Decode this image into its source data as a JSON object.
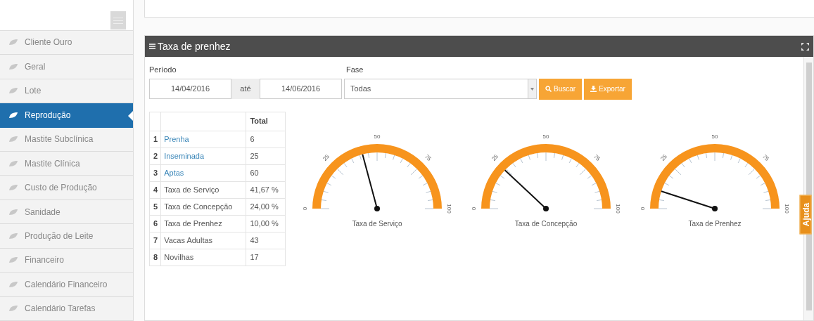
{
  "sidebar": {
    "items": [
      {
        "label": "Cliente Ouro",
        "selected": false
      },
      {
        "label": "Geral",
        "selected": false
      },
      {
        "label": "Lote",
        "selected": false
      },
      {
        "label": "Reprodução",
        "selected": true
      },
      {
        "label": "Mastite Subclínica",
        "selected": false
      },
      {
        "label": "Mastite Clínica",
        "selected": false
      },
      {
        "label": "Custo de Produção",
        "selected": false
      },
      {
        "label": "Sanidade",
        "selected": false
      },
      {
        "label": "Produção de Leite",
        "selected": false
      },
      {
        "label": "Financeiro",
        "selected": false
      },
      {
        "label": "Calendário Financeiro",
        "selected": false
      },
      {
        "label": "Calendário Tarefas",
        "selected": false
      }
    ]
  },
  "panel": {
    "title": "Taxa de prenhez",
    "filters": {
      "period_label": "Período",
      "start_date": "14/04/2016",
      "separator": "até",
      "end_date": "14/06/2016",
      "phase_label": "Fase",
      "phase_value": "Todas"
    },
    "buttons": [
      {
        "label": "Buscar",
        "kind": "search"
      },
      {
        "label": "Exportar",
        "kind": "export"
      }
    ],
    "table": {
      "columns": [
        "Total"
      ],
      "rows": [
        {
          "index": "1",
          "label": "Prenha",
          "link": true,
          "total": "6"
        },
        {
          "index": "2",
          "label": "Inseminada",
          "link": true,
          "total": "25"
        },
        {
          "index": "3",
          "label": "Aptas",
          "link": true,
          "total": "60"
        },
        {
          "index": "4",
          "label": "Taxa de Serviço",
          "link": false,
          "total": "41,67 %"
        },
        {
          "index": "5",
          "label": "Taxa de Concepção",
          "link": false,
          "total": "24,00 %"
        },
        {
          "index": "6",
          "label": "Taxa de Prenhez",
          "link": false,
          "total": "10,00 %"
        },
        {
          "index": "7",
          "label": "Vacas Adultas",
          "link": false,
          "total": "43"
        },
        {
          "index": "8",
          "label": "Novilhas",
          "link": false,
          "total": "17"
        }
      ]
    },
    "gauges": [
      {
        "title": "Taxa de Serviço",
        "level": 0.4167,
        "tick_labels": [
          "0",
          "25",
          "50",
          "75",
          "100"
        ]
      },
      {
        "title": "Taxa de Concepção",
        "level": 0.24,
        "tick_labels": [
          "0",
          "25",
          "50",
          "75",
          "100"
        ]
      },
      {
        "title": "Taxa de Prenhez",
        "level": 0.1,
        "tick_labels": [
          "0",
          "25",
          "50",
          "75",
          "100"
        ]
      }
    ]
  },
  "help_tab": "Ajuda"
}
